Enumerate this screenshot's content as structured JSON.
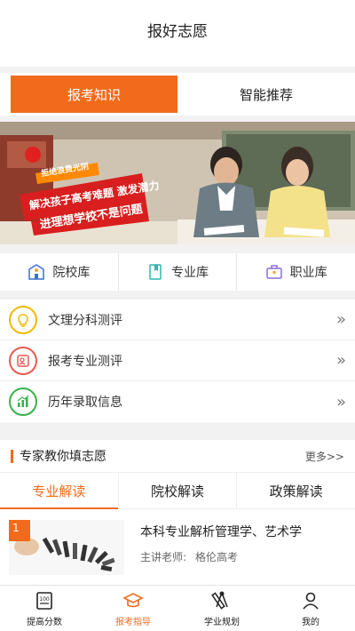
{
  "header": {
    "title": "报好志愿"
  },
  "top_tabs": [
    {
      "label": "报考知识",
      "active": true
    },
    {
      "label": "智能推荐",
      "active": false
    }
  ],
  "banner": {
    "tag": "拒绝浪费光阴",
    "line1": "解决孩子高考难题 激发潜力",
    "line2": "进理想学校不是问题"
  },
  "quick_links": [
    {
      "label": "院校库",
      "icon": "school-icon"
    },
    {
      "label": "专业库",
      "icon": "book-icon"
    },
    {
      "label": "职业库",
      "icon": "briefcase-icon"
    }
  ],
  "list": [
    {
      "label": "文理分科测评",
      "icon": "bulb-icon",
      "color": "#f5b800"
    },
    {
      "label": "报考专业测评",
      "icon": "profile-icon",
      "color": "#e85a4f"
    },
    {
      "label": "历年录取信息",
      "icon": "chart-icon",
      "color": "#36b24a"
    }
  ],
  "list_arrow": "»",
  "section": {
    "title": "专家教你填志愿",
    "more": "更多>>",
    "tabs": [
      {
        "label": "专业解读",
        "active": true
      },
      {
        "label": "院校解读",
        "active": false
      },
      {
        "label": "政策解读",
        "active": false
      }
    ],
    "course": {
      "rank": "1",
      "title": "本科专业解析管理学、艺术学",
      "teacher_label": "主讲老师:",
      "teacher_name": "格伦高考"
    }
  },
  "bottom_nav": [
    {
      "label": "提高分数",
      "icon": "score-icon",
      "active": false
    },
    {
      "label": "报考指导",
      "icon": "graduation-cap-icon",
      "active": true
    },
    {
      "label": "学业规划",
      "icon": "compass-ruler-icon",
      "active": false
    },
    {
      "label": "我的",
      "icon": "user-icon",
      "active": false
    }
  ],
  "colors": {
    "accent": "#f26b1d",
    "yellow": "#f5b800",
    "red": "#e85a4f",
    "green": "#36b24a"
  }
}
